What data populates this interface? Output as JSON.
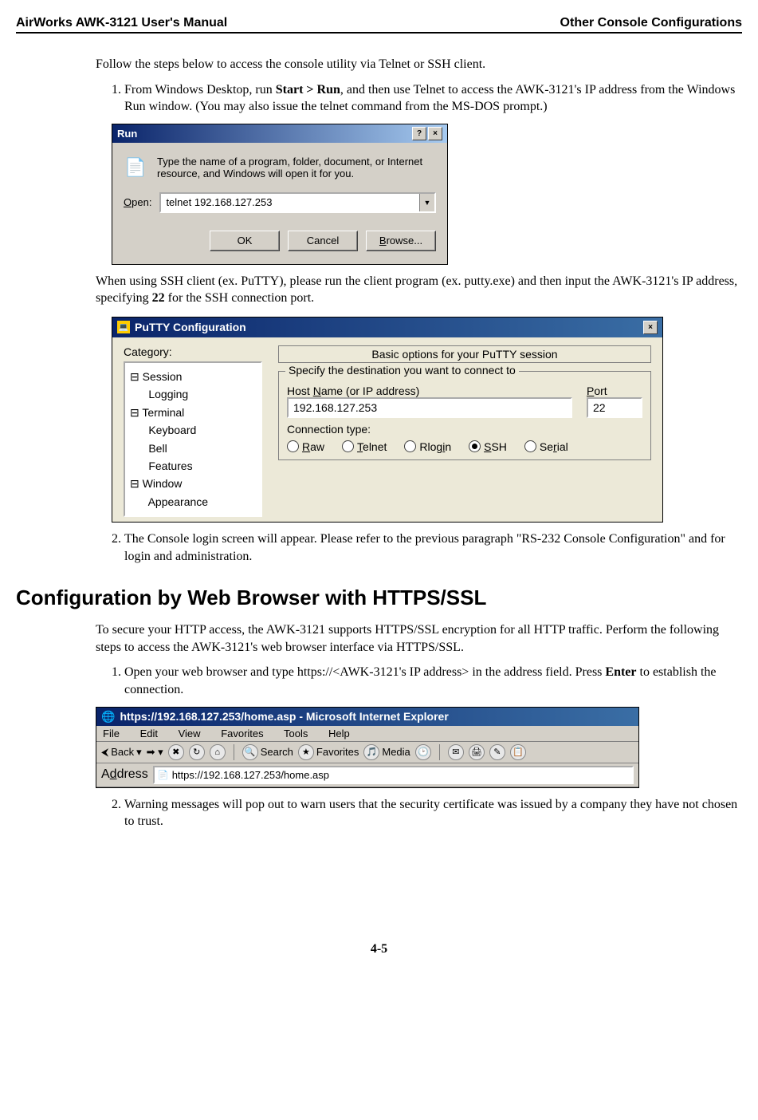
{
  "header": {
    "left": "AirWorks AWK-3121 User's Manual",
    "right": "Other Console Configurations"
  },
  "intro_para": "Follow the steps below to access the console utility via Telnet or SSH client.",
  "step1_pre": "From Windows Desktop, run ",
  "step1_bold": "Start > Run",
  "step1_post": ", and then use Telnet to access the AWK-3121's IP address from the Windows Run window. (You may also issue the telnet command from the MS-DOS prompt.)",
  "run": {
    "title": "Run",
    "desc": "Type the name of a program, folder, document, or Internet resource, and Windows will open it for you.",
    "open_label_letter": "O",
    "open_label_rest": "pen:",
    "value": "telnet 192.168.127.253",
    "ok": "OK",
    "cancel": "Cancel",
    "browse_letter": "B",
    "browse_rest": "rowse..."
  },
  "ssh_para_pre": "When using SSH client (ex. PuTTY), please run the client program (ex. putty.exe) and then input the AWK-3121's IP address, specifying ",
  "ssh_para_bold": "22",
  "ssh_para_post": " for the SSH connection port.",
  "putty": {
    "title": "PuTTY Configuration",
    "category_label": "Category:",
    "tree_session": "⊟ Session",
    "tree_logging": "      Logging",
    "tree_terminal": "⊟ Terminal",
    "tree_keyboard": "      Keyboard",
    "tree_bell": "      Bell",
    "tree_features": "      Features",
    "tree_window": "⊟ Window",
    "tree_appearance": "      Appearance",
    "basic_title": "Basic options for your PuTTY session",
    "group_legend": "Specify the destination you want to connect to",
    "host_label_pre": "Host ",
    "host_label_u": "N",
    "host_label_post": "ame (or IP address)",
    "port_label_u": "P",
    "port_label_post": "ort",
    "host_value": "192.168.127.253",
    "port_value": "22",
    "conn_type": "Connection type:",
    "raw_u": "R",
    "raw_post": "aw",
    "telnet_u": "T",
    "telnet_post": "elnet",
    "rlogin_pre": "Rlog",
    "rlogin_u": "i",
    "rlogin_post": "n",
    "ssh_u": "S",
    "ssh_post": "SH",
    "serial_pre": "Se",
    "serial_u": "r",
    "serial_post": "ial"
  },
  "step2_text": "The Console login screen will appear. Please refer to the previous paragraph \"RS-232 Console Configuration\" and for login and administration.",
  "section_heading": "Configuration by Web Browser with HTTPS/SSL",
  "https_para": "To secure your HTTP access, the AWK-3121 supports HTTPS/SSL encryption for all HTTP traffic. Perform the following steps to access the AWK-3121's web browser interface via HTTPS/SSL.",
  "https_step1_pre": "Open your web browser and type https://<AWK-3121's IP address> in the address field. Press ",
  "https_step1_bold": "Enter",
  "https_step1_post": " to establish the connection.",
  "ie": {
    "title": "https://192.168.127.253/home.asp - Microsoft Internet Explorer",
    "menu": {
      "file": "File",
      "edit": "Edit",
      "view": "View",
      "favorites": "Favorites",
      "tools": "Tools",
      "help": "Help"
    },
    "back": "Back",
    "search": "Search",
    "favorites_btn": "Favorites",
    "media": "Media",
    "address_label_u": "d",
    "address_label_pre": "A",
    "address_label_post": "dress",
    "url": "https://192.168.127.253/home.asp"
  },
  "https_step2": "Warning messages will pop out to warn users that the security certificate was issued by a company they have not chosen to trust.",
  "page_number": "4-5"
}
